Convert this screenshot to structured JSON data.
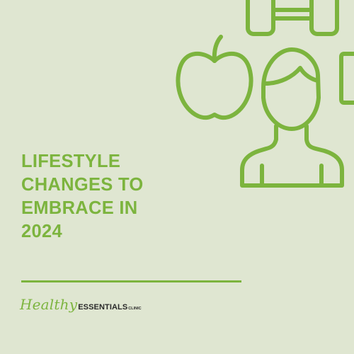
{
  "title_lines": [
    "LIFESTYLE",
    "CHANGES TO",
    "EMBRACE IN",
    "2024"
  ],
  "logo": {
    "script": "Healthy",
    "main": "ESSENTIALS",
    "sub": "CLINIC"
  },
  "colors": {
    "background": "#dfe6d1",
    "accent": "#7cb43e",
    "logo_text": "#2a2a2a"
  },
  "icons": [
    "dumbbell-icon",
    "apple-icon",
    "person-icon",
    "phone-icon"
  ]
}
